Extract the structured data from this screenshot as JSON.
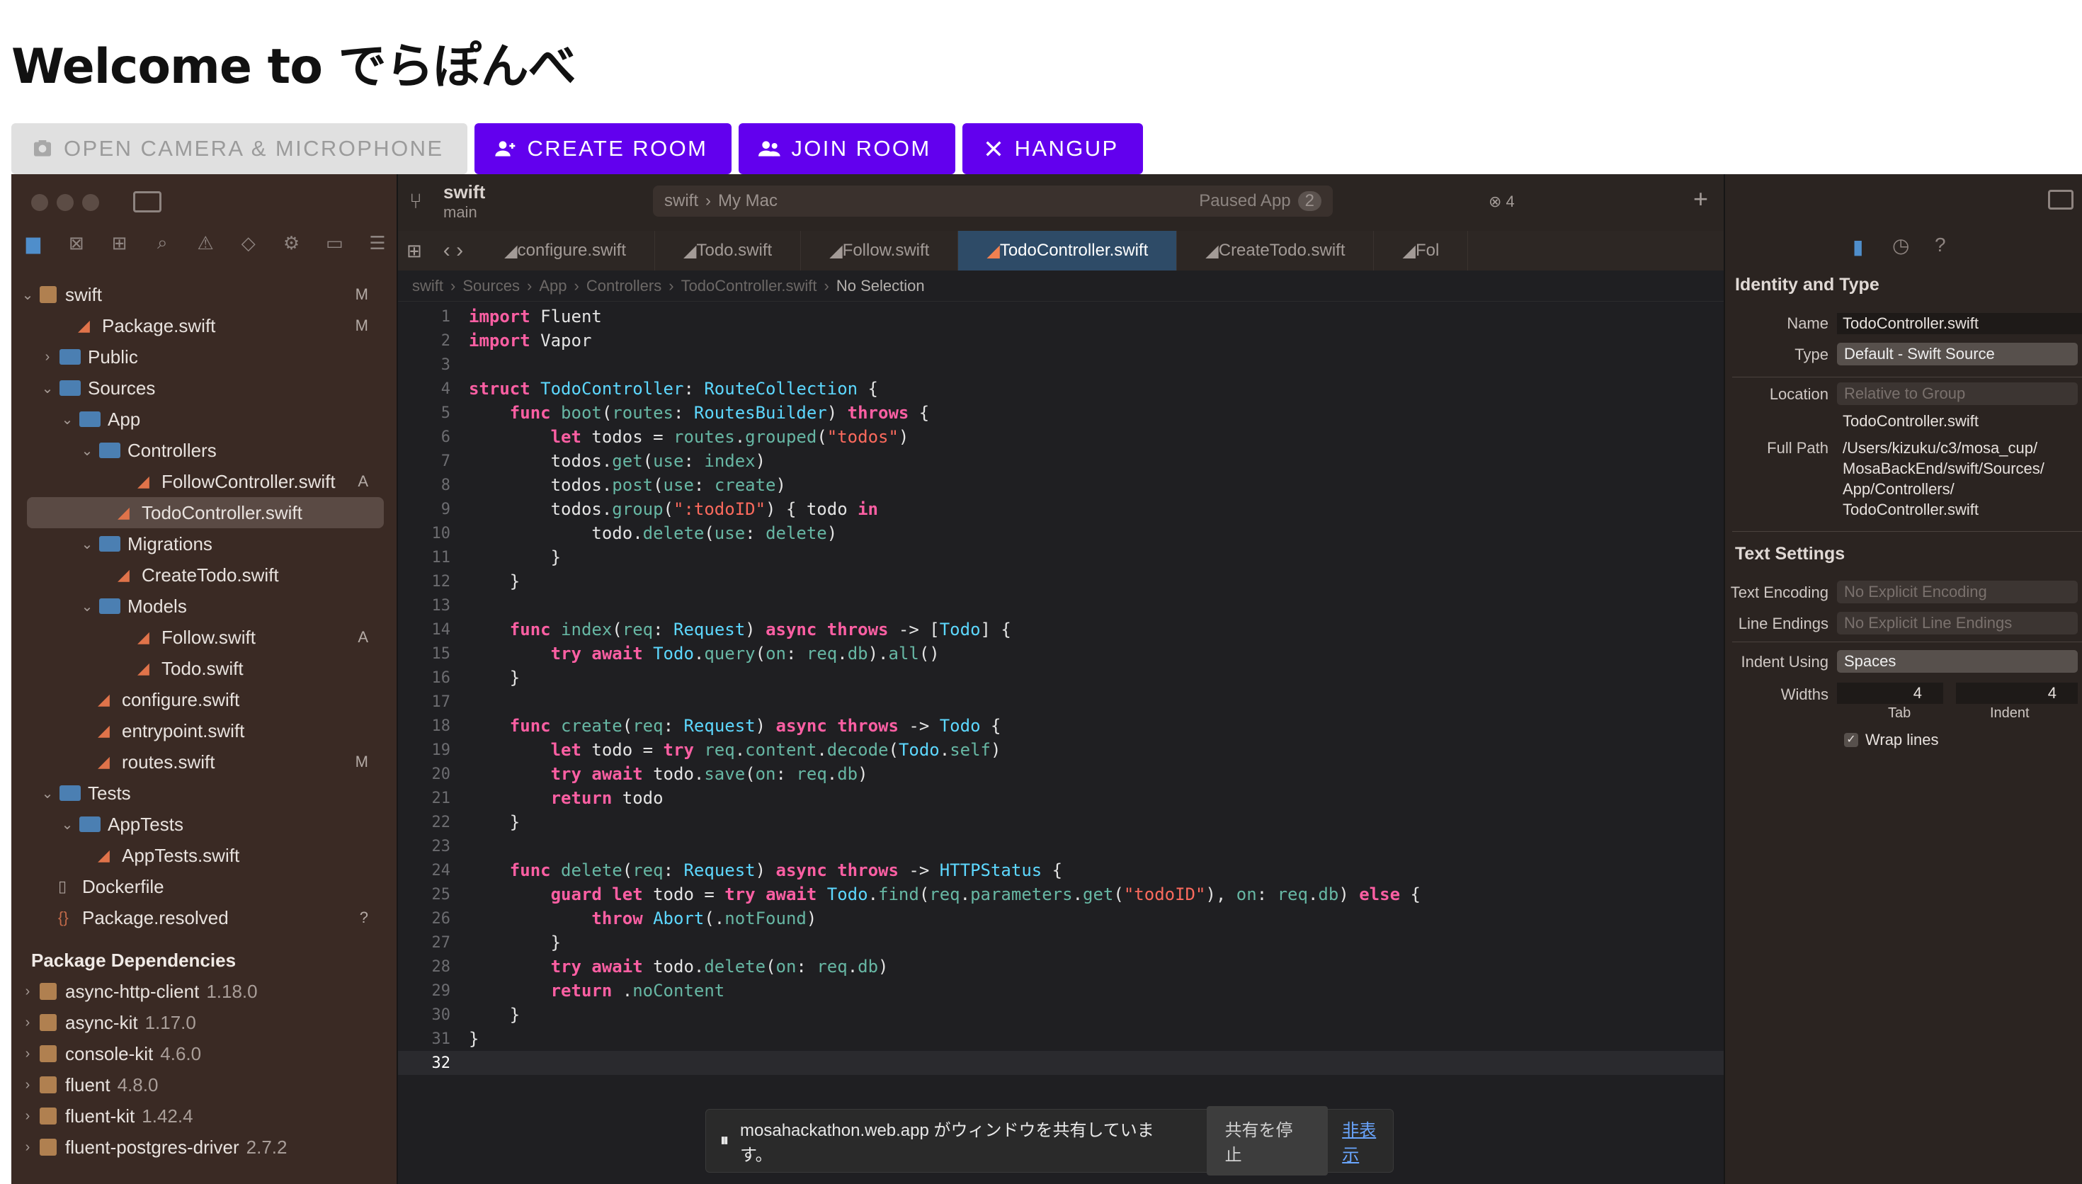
{
  "page_title": "Welcome to でらぽんべ",
  "buttons": {
    "open_camera": "OPEN CAMERA & MICROPHONE",
    "create_room": "CREATE ROOM",
    "join_room": "JOIN ROOM",
    "hangup": "HANGUP"
  },
  "xcode": {
    "branch_name": "swift",
    "branch_sub": "main",
    "scheme_project": "swift",
    "scheme_destination": "My Mac",
    "status": "Paused App",
    "status_count": "2",
    "error_count": "4",
    "tabs": [
      "configure.swift",
      "Todo.swift",
      "Follow.swift",
      "TodoController.swift",
      "CreateTodo.swift",
      "Fol"
    ],
    "active_tab_index": 3,
    "breadcrumb": [
      "swift",
      "Sources",
      "App",
      "Controllers",
      "TodoController.swift",
      "No Selection"
    ],
    "navigator": [
      {
        "label": "swift",
        "badge": "M"
      },
      {
        "label": "Package.swift",
        "badge": "M"
      },
      {
        "label": "Public",
        "badge": ""
      },
      {
        "label": "Sources",
        "badge": ""
      },
      {
        "label": "App",
        "badge": ""
      },
      {
        "label": "Controllers",
        "badge": ""
      },
      {
        "label": "FollowController.swift",
        "badge": "A"
      },
      {
        "label": "TodoController.swift",
        "badge": ""
      },
      {
        "label": "Migrations",
        "badge": ""
      },
      {
        "label": "CreateTodo.swift",
        "badge": ""
      },
      {
        "label": "Models",
        "badge": ""
      },
      {
        "label": "Follow.swift",
        "badge": "A"
      },
      {
        "label": "Todo.swift",
        "badge": ""
      },
      {
        "label": "configure.swift",
        "badge": ""
      },
      {
        "label": "entrypoint.swift",
        "badge": ""
      },
      {
        "label": "routes.swift",
        "badge": "M"
      },
      {
        "label": "Tests",
        "badge": ""
      },
      {
        "label": "AppTests",
        "badge": ""
      },
      {
        "label": "AppTests.swift",
        "badge": ""
      },
      {
        "label": "Dockerfile",
        "badge": ""
      },
      {
        "label": "Package.resolved",
        "badge": "?"
      }
    ],
    "package_dependencies_title": "Package Dependencies",
    "dependencies": [
      {
        "name": "async-http-client",
        "version": "1.18.0"
      },
      {
        "name": "async-kit",
        "version": "1.17.0"
      },
      {
        "name": "console-kit",
        "version": "4.6.0"
      },
      {
        "name": "fluent",
        "version": "4.8.0"
      },
      {
        "name": "fluent-kit",
        "version": "1.42.4"
      },
      {
        "name": "fluent-postgres-driver",
        "version": "2.7.2"
      }
    ],
    "code_lines": [
      "import Fluent",
      "import Vapor",
      "",
      "struct TodoController: RouteCollection {",
      "    func boot(routes: RoutesBuilder) throws {",
      "        let todos = routes.grouped(\"todos\")",
      "        todos.get(use: index)",
      "        todos.post(use: create)",
      "        todos.group(\":todoID\") { todo in",
      "            todo.delete(use: delete)",
      "        }",
      "    }",
      "",
      "    func index(req: Request) async throws -> [Todo] {",
      "        try await Todo.query(on: req.db).all()",
      "    }",
      "",
      "    func create(req: Request) async throws -> Todo {",
      "        let todo = try req.content.decode(Todo.self)",
      "        try await todo.save(on: req.db)",
      "        return todo",
      "    }",
      "",
      "    func delete(req: Request) async throws -> HTTPStatus {",
      "        guard let todo = try await Todo.find(req.parameters.get(\"todoID\"), on: req.db) else {",
      "            throw Abort(.notFound)",
      "        }",
      "        try await todo.delete(on: req.db)",
      "        return .noContent",
      "    }",
      "}",
      ""
    ],
    "inspector": {
      "identity_title": "Identity and Type",
      "name_label": "Name",
      "name_value": "TodoController.swift",
      "type_label": "Type",
      "type_value": "Default - Swift Source",
      "location_label": "Location",
      "location_value": "Relative to Group",
      "location_file": "TodoController.swift",
      "fullpath_label": "Full Path",
      "fullpath_lines": [
        "/Users/kizuku/c3/mosa_cup/",
        "MosaBackEnd/swift/Sources/",
        "App/Controllers/",
        "TodoController.swift"
      ],
      "text_settings_title": "Text Settings",
      "encoding_label": "Text Encoding",
      "encoding_value": "No Explicit Encoding",
      "endings_label": "Line Endings",
      "endings_value": "No Explicit Line Endings",
      "indent_label": "Indent Using",
      "indent_value": "Spaces",
      "widths_label": "Widths",
      "tab_width": "4",
      "indent_width": "4",
      "tab_caption": "Tab",
      "indent_caption": "Indent",
      "wrap_label": "Wrap lines"
    },
    "share_banner": {
      "message": "mosahackathon.web.app がウィンドウを共有しています。",
      "stop": "共有を停止",
      "hide": "非表示"
    }
  },
  "colors": {
    "primary": "#6200ee",
    "disabled": "#e0e0e0"
  }
}
